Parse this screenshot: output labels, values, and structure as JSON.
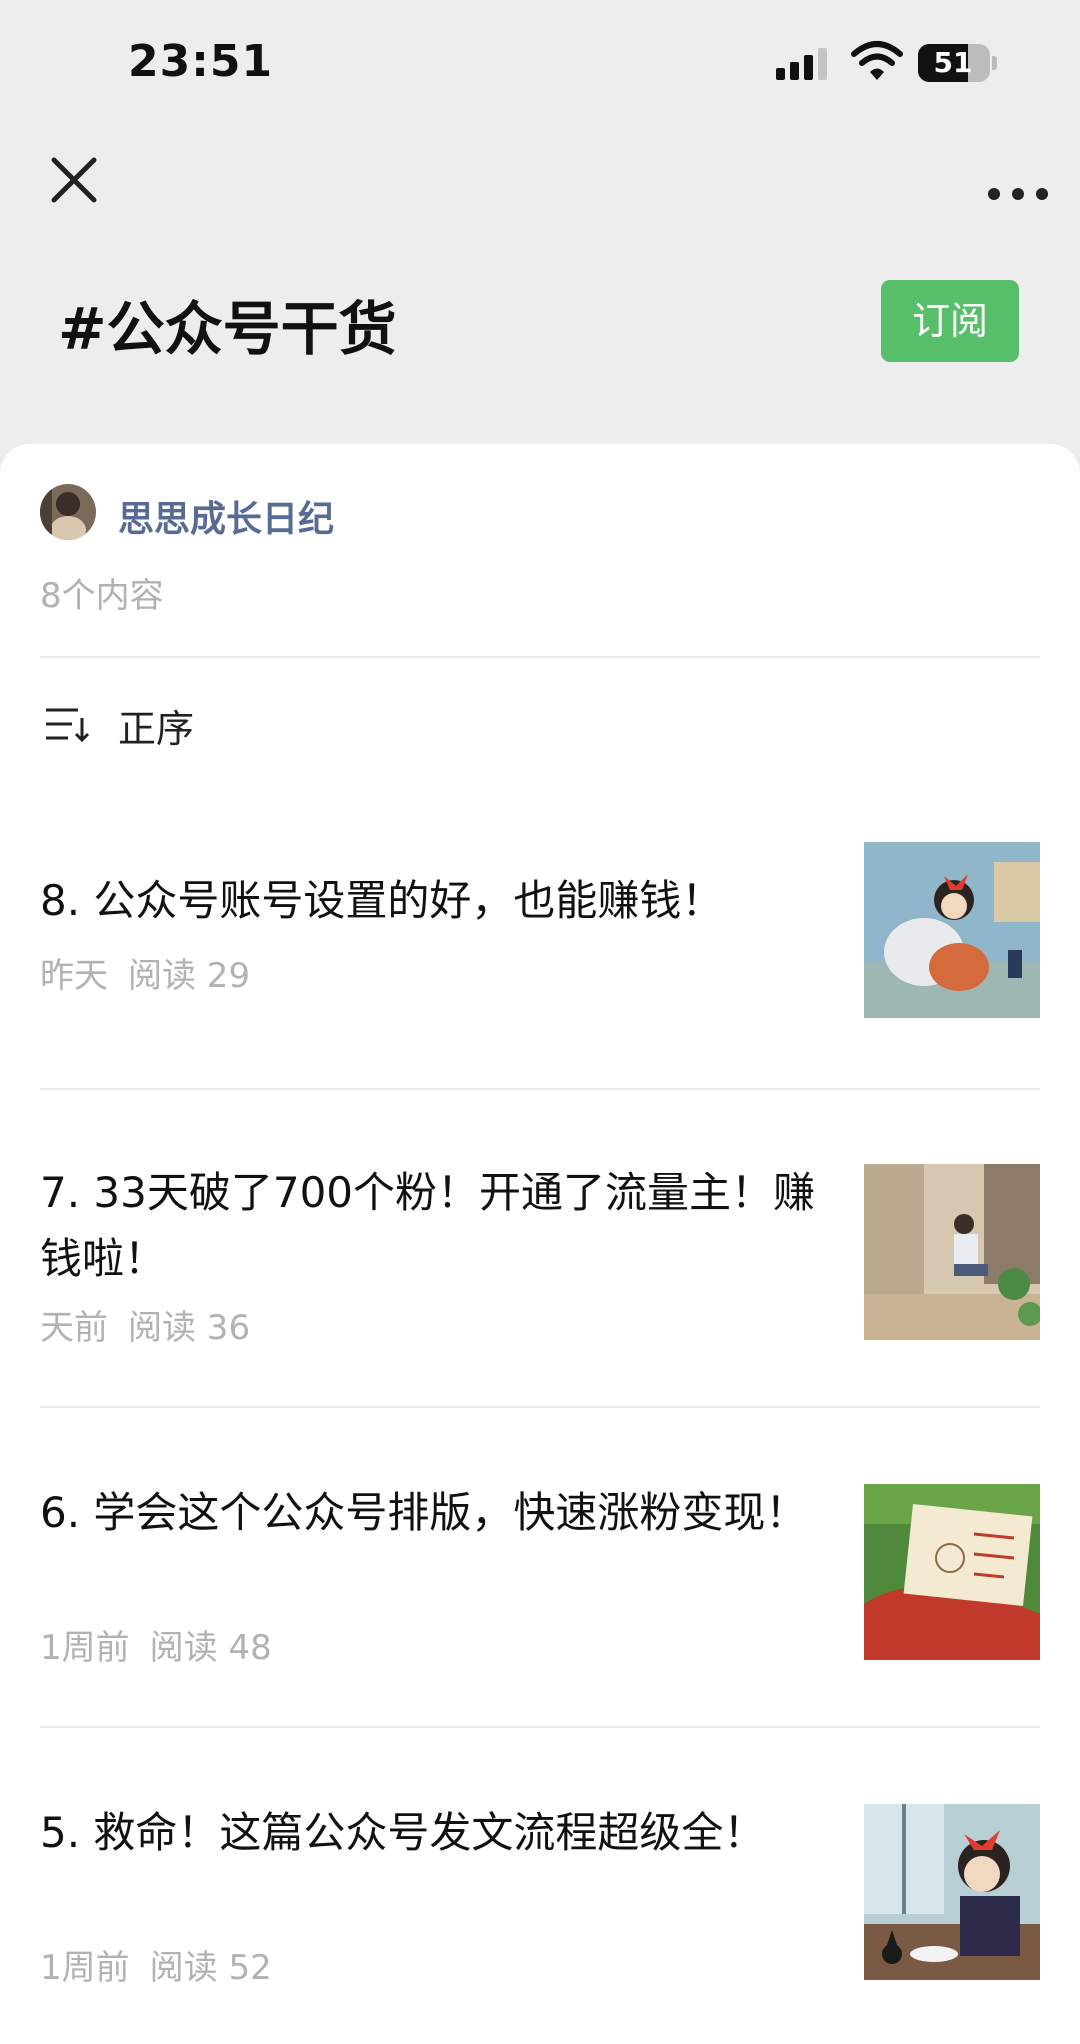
{
  "status_bar": {
    "time": "23:51",
    "battery": "51"
  },
  "nav": {
    "close_icon": "close-icon",
    "more_icon": "more-icon"
  },
  "topic": {
    "title": "#公众号干货",
    "subscribe_label": "订阅",
    "accent": "#57be6a"
  },
  "author": {
    "name": "思思成长日纪",
    "link_color": "#576b95"
  },
  "content_count": "8个内容",
  "sort": {
    "label": "正序",
    "icon": "sort-icon"
  },
  "articles": [
    {
      "title": "8. 公众号账号设置的好，也能赚钱！",
      "time": "昨天",
      "reads": "阅读 29"
    },
    {
      "title": "7. 33天破了700个粉！开通了流量主！赚钱啦！",
      "time": "天前",
      "reads": "阅读 36"
    },
    {
      "title": "6. 学会这个公众号排版，快速涨粉变现！",
      "time": "1周前",
      "reads": "阅读 48"
    },
    {
      "title": "5. 救命！这篇公众号发文流程超级全！",
      "time": "1周前",
      "reads": "阅读 52"
    }
  ]
}
